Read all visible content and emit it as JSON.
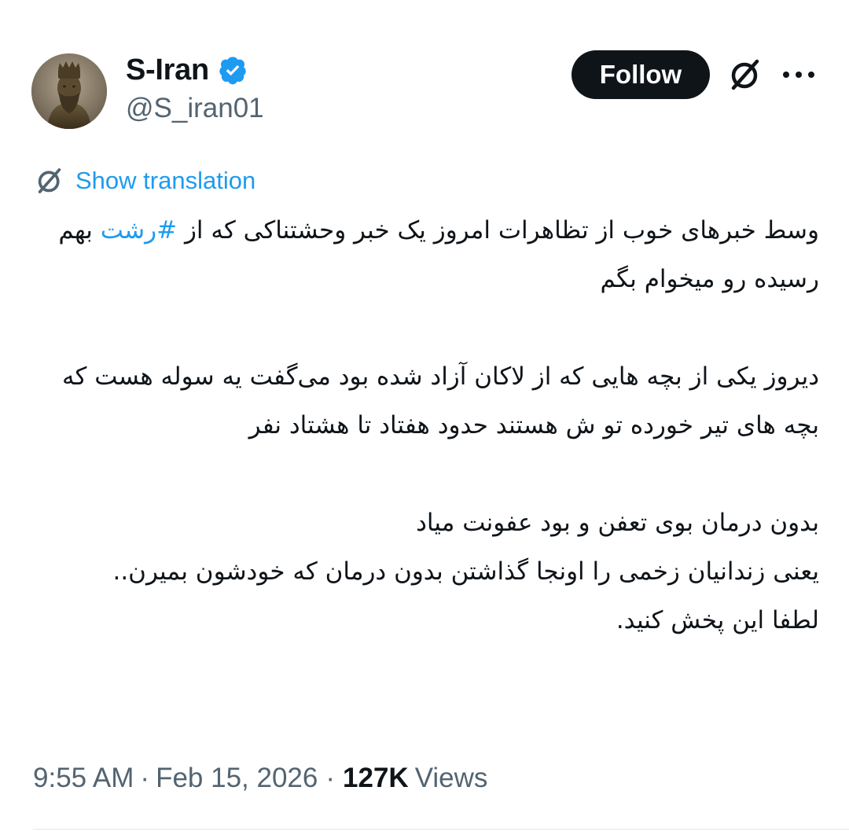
{
  "author": {
    "display_name": "S-Iran",
    "handle": "@S_iran01",
    "verified": true,
    "avatar_icon": "statue-portrait-avatar"
  },
  "header_actions": {
    "follow_label": "Follow",
    "grok_icon": "grok-icon",
    "more_icon": "more-horizontal-icon"
  },
  "translation": {
    "label": "Show translation",
    "icon": "grok-translate-icon"
  },
  "tweet": {
    "para1_line1": "وسط خبرهای خوب از تظاهرات امروز یک خبر وحشتناکی که از",
    "para1_hashtag": "#رشت",
    "para1_line2_rest": " بهم رسیده رو میخوام بگم",
    "para2": "دیروز یکی از بچه هایی که از لاکان آزاد شده بود می‌گفت یه سوله هست که بچه های تیر خورده تو ش هستند حدود هفتاد تا هشتاد نفر",
    "para3_line1": "بدون درمان بوی تعفن و بود عفونت میاد",
    "para3_line2": "یعنی زندانیان زخمی را اونجا گذاشتن بدون درمان که خودشون بمیرن..",
    "para3_line3": "لطفا این پخش کنید."
  },
  "meta": {
    "time": "9:55 AM",
    "separator": "·",
    "date": "Feb 15, 2026",
    "views_count": "127K",
    "views_label": "Views"
  },
  "colors": {
    "accent": "#1d9bf0",
    "text": "#0f1419",
    "secondary_text": "#536471",
    "follow_bg": "#0f1419"
  }
}
